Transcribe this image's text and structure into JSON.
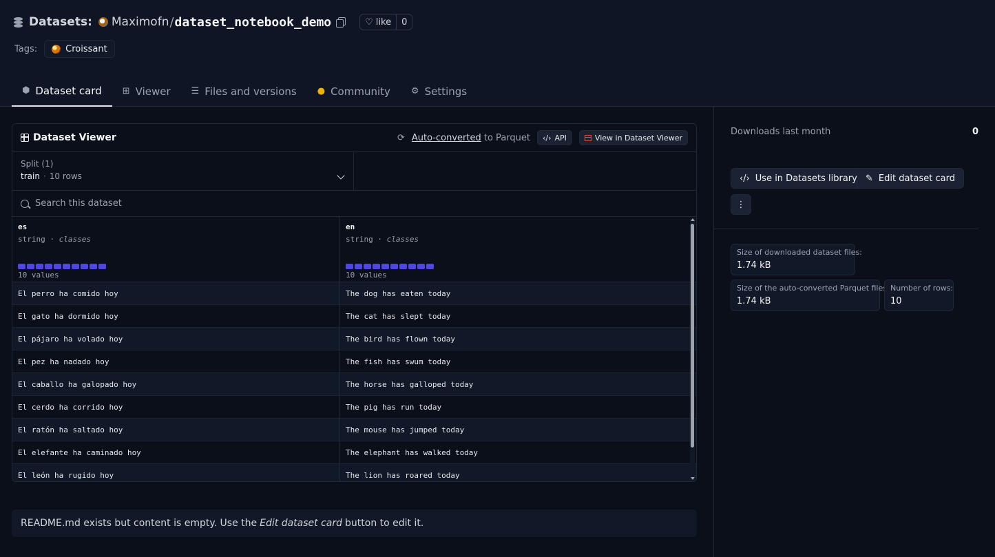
{
  "header": {
    "section": "Datasets:",
    "owner": "Maximofn",
    "separator": "/",
    "repo": "dataset_notebook_demo",
    "like_label": "like",
    "like_count": "0",
    "tags_label": "Tags:",
    "tags": [
      {
        "label": "Croissant",
        "icon": "croissant-icon"
      }
    ]
  },
  "tabs": [
    {
      "label": "Dataset card",
      "icon": "cube-icon",
      "active": true
    },
    {
      "label": "Viewer",
      "icon": "table-icon",
      "active": false
    },
    {
      "label": "Files and versions",
      "icon": "files-icon",
      "active": false
    },
    {
      "label": "Community",
      "icon": "community-icon",
      "active": false
    },
    {
      "label": "Settings",
      "icon": "gear-icon",
      "active": false
    }
  ],
  "viewer": {
    "title": "Dataset Viewer",
    "auto_converted_link": "Auto-converted",
    "auto_converted_suffix": "to Parquet",
    "api_label": "API",
    "view_label": "View in Dataset Viewer",
    "split_label": "Split (1)",
    "split_name": "train",
    "split_rows": "10 rows",
    "search_placeholder": "Search this dataset",
    "columns": [
      {
        "name": "es",
        "type": "string",
        "kind": "classes",
        "values_label": "10 values",
        "bar_count": 10
      },
      {
        "name": "en",
        "type": "string",
        "kind": "classes",
        "values_label": "10 values",
        "bar_count": 10
      }
    ],
    "rows": [
      [
        "El perro ha comido hoy",
        "The dog has eaten today"
      ],
      [
        "El gato ha dormido hoy",
        "The cat has slept today"
      ],
      [
        "El pájaro ha volado hoy",
        "The bird has flown today"
      ],
      [
        "El pez ha nadado hoy",
        "The fish has swum today"
      ],
      [
        "El caballo ha galopado hoy",
        "The horse has galloped today"
      ],
      [
        "El cerdo ha corrido hoy",
        "The pig has run today"
      ],
      [
        "El ratón ha saltado hoy",
        "The mouse has jumped today"
      ],
      [
        "El elefante ha caminado hoy",
        "The elephant has walked today"
      ],
      [
        "El león ha rugido hoy",
        "The lion has roared today"
      ]
    ]
  },
  "readme": {
    "prefix": "README.md exists but content is empty. Use the",
    "emph": "Edit dataset card",
    "suffix": "button to edit it."
  },
  "sidebar": {
    "downloads_label": "Downloads last month",
    "downloads_count": "0",
    "use_library_label": "Use in Datasets library",
    "edit_card_label": "Edit dataset card",
    "more_label": "⋮",
    "stats": [
      {
        "label": "Size of downloaded dataset files:",
        "value": "1.74 kB"
      },
      {
        "label": "Size of the auto-converted Parquet files:",
        "value": "1.74 kB"
      },
      {
        "label": "Number of rows:",
        "value": "10"
      }
    ]
  },
  "colors": {
    "background": "#0b0f19",
    "accent_bar": "#4f46e5",
    "viewer_icon": "#ef4444"
  }
}
